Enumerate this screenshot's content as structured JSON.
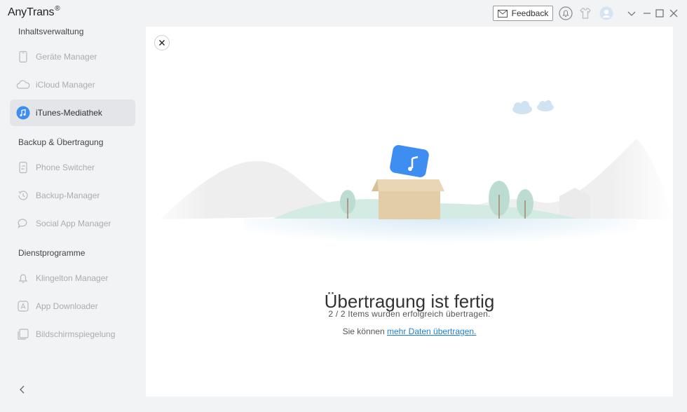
{
  "app": {
    "title": "AnyTrans",
    "trademark": "®"
  },
  "toolbar": {
    "feedback_label": "Feedback"
  },
  "sidebar": {
    "sections": [
      {
        "title": "Inhaltsverwaltung"
      },
      {
        "title": "Backup & Übertragung"
      },
      {
        "title": "Dienstprogramme"
      }
    ],
    "items": [
      {
        "label": "Geräte Manager",
        "icon": "phone-icon"
      },
      {
        "label": "iCloud Manager",
        "icon": "cloud-icon"
      },
      {
        "label": "iTunes-Mediathek",
        "icon": "music-note-icon",
        "active": true
      },
      {
        "label": "Phone Switcher",
        "icon": "phone-switch-icon"
      },
      {
        "label": "Backup-Manager",
        "icon": "clock-history-icon"
      },
      {
        "label": "Social App Manager",
        "icon": "chat-bubble-icon"
      },
      {
        "label": "Klingelton Manager",
        "icon": "bell-icon"
      },
      {
        "label": "App Downloader",
        "icon": "app-store-icon"
      },
      {
        "label": "Bildschirmspiegelung",
        "icon": "screen-mirror-icon"
      }
    ]
  },
  "main": {
    "headline": "Übertragung ist fertig",
    "subtext": "2 / 2 Items wurden erfolgreich übertragen.",
    "more_prefix": "Sie können ",
    "more_link": "mehr Daten übertragen."
  },
  "colors": {
    "accent": "#1a7fd8",
    "itunes_blue": "#3d8ef0",
    "sidebar_bg": "#f2f3f5",
    "active_item_bg": "#e3e5e8"
  }
}
